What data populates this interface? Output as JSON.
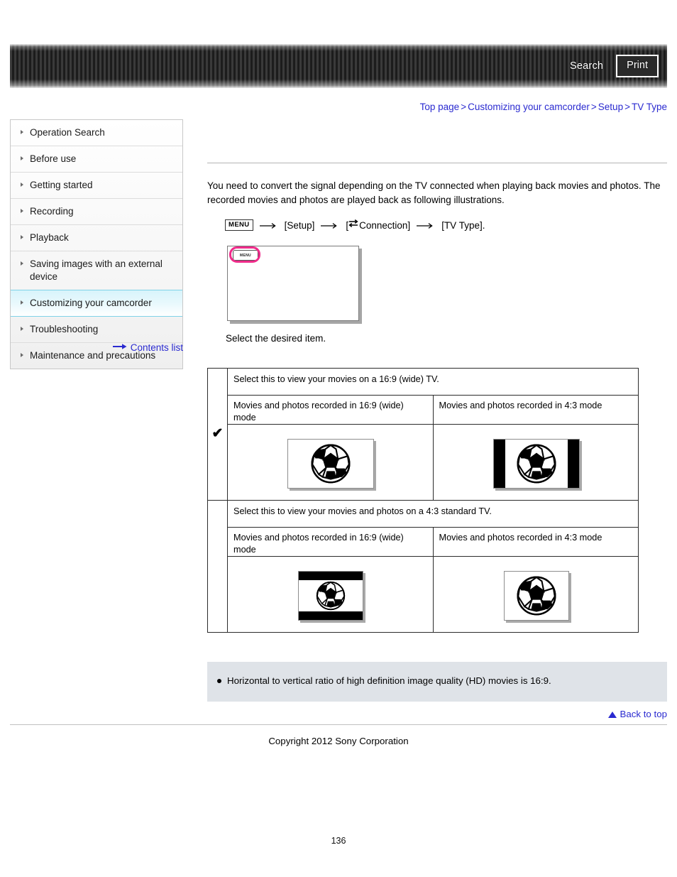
{
  "header": {
    "search_label": "Search",
    "print_label": "Print"
  },
  "breadcrumb": {
    "items": [
      "Top page",
      "Customizing your camcorder",
      "Setup",
      "TV Type"
    ],
    "separator": ">"
  },
  "sidebar": {
    "items": [
      {
        "label": "Operation Search",
        "active": false
      },
      {
        "label": "Before use",
        "active": false
      },
      {
        "label": "Getting started",
        "active": false
      },
      {
        "label": "Recording",
        "active": false
      },
      {
        "label": "Playback",
        "active": false
      },
      {
        "label": "Saving images with an external device",
        "active": false
      },
      {
        "label": "Customizing your camcorder",
        "active": true
      },
      {
        "label": "Troubleshooting",
        "active": false
      },
      {
        "label": "Maintenance and precautions",
        "active": false
      }
    ],
    "contents_list_label": "Contents list"
  },
  "main": {
    "intro_line1": "You need to convert the signal depending on the TV connected when playing back movies and photos.",
    "intro_line2": "The recorded movies and photos are played back as following illustrations.",
    "menu_path": {
      "menu_chip": "MENU",
      "arrow": "→",
      "step1": "[Setup]",
      "step2_prefix": "[",
      "step2_label": "Connection]",
      "step3": "[TV Type]."
    },
    "screen_illustration": {
      "menu_button_label": "MENU",
      "highlight_color": "#ef2b8a"
    },
    "select_caption": "Select the desired item.",
    "table": {
      "rows": [
        {
          "checked": true,
          "check_glyph": "✔",
          "description": "Select this to view your movies on a 16:9 (wide) TV.",
          "left_label": "Movies and photos recorded in 16:9 (wide) mode",
          "left_illustration": "wide-16-9-fullscreen",
          "right_label": "Movies and photos recorded in 4:3 mode",
          "right_illustration": "wide-16-9-pillarboxed"
        },
        {
          "checked": false,
          "check_glyph": "",
          "description": "Select this to view your movies and photos on a 4:3 standard TV.",
          "left_label": "Movies and photos recorded in 16:9 (wide) mode",
          "left_illustration": "std-4-3-letterboxed",
          "right_label": "Movies and photos recorded in 4:3 mode",
          "right_illustration": "std-4-3-fullscreen"
        }
      ]
    },
    "note": "Horizontal to vertical ratio of high definition image quality (HD) movies is 16:9.",
    "back_to_top_label": "Back to top",
    "copyright": "Copyright 2012 Sony Corporation"
  },
  "page_number": "136"
}
